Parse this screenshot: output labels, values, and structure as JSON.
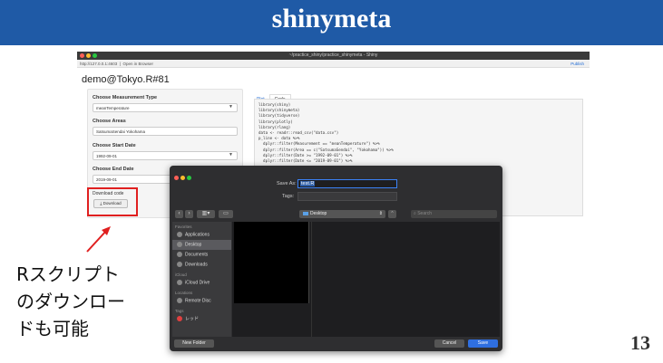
{
  "slide": {
    "title": "shinymeta",
    "page_number": "13"
  },
  "window": {
    "title": "~/practice_shiny/practice_shinymeta - Shiny",
    "url": "http://127.0.0.1:4603",
    "open_in_browser": "Open in Browser",
    "publish": "Publish",
    "traffic_colors": [
      "#ff5f57",
      "#febc2e",
      "#28c840"
    ]
  },
  "app": {
    "title": "demo@Tokyo.R#81",
    "fields": [
      {
        "label": "Choose Measurement Type",
        "value": "meanTemperature",
        "dropdown": true
      },
      {
        "label": "Choose Areas",
        "value": "SatsumaSendai   Yokohama",
        "dropdown": false
      },
      {
        "label": "Choose Start Date",
        "value": "1992-09-01",
        "dropdown": true
      },
      {
        "label": "Choose End Date",
        "value": "2019-09-01",
        "dropdown": false
      }
    ],
    "download": {
      "label": "Download code",
      "button": "Download"
    },
    "tabs": [
      "Plot",
      "Code"
    ],
    "active_tab": "Code",
    "code": "library(shiny)\nlibrary(shinymeta)\nlibrary(tidyverse)\nlibrary(plotly)\nlibrary(rlang)\ndata <- readr::read_csv(\"data.csv\")\np_line <- data %>%\n  dplyr::filter(Measurement == \"meanTemperature\") %>%\n  dplyr::filter(Area == c(\"SatsumaSendai\", \"Yokohama\")) %>%\n  dplyr::filter(Date >= \"1992-09-01\") %>%\n  dplyr::filter(Date <= \"2019-09-01\") %>%"
  },
  "dialog": {
    "save_as_label": "Save As:",
    "save_as_value": "test.R",
    "tags_label": "Tags:",
    "location": "Desktop",
    "search_placeholder": "Search",
    "sidebar": [
      {
        "heading": "Favorites",
        "items": [
          {
            "label": "Applications",
            "icon": "applications-icon",
            "selected": false
          },
          {
            "label": "Desktop",
            "icon": "desktop-icon",
            "selected": true
          },
          {
            "label": "Documents",
            "icon": "documents-icon",
            "selected": false
          },
          {
            "label": "Downloads",
            "icon": "downloads-icon",
            "selected": false
          }
        ]
      },
      {
        "heading": "iCloud",
        "items": [
          {
            "label": "iCloud Drive",
            "icon": "cloud-icon",
            "selected": false
          }
        ]
      },
      {
        "heading": "Locations",
        "items": [
          {
            "label": "Remote Disc",
            "icon": "disc-icon",
            "selected": false
          }
        ]
      },
      {
        "heading": "Tags",
        "items": [
          {
            "label": "レッド",
            "icon": "tag-red-icon",
            "selected": false
          }
        ]
      }
    ],
    "buttons": {
      "new_folder": "New Folder",
      "cancel": "Cancel",
      "save": "Save"
    }
  },
  "annotation": {
    "lines": [
      "Rスクリプト",
      "のダウンロー",
      "ドも可能"
    ],
    "highlight_color": "#e02020"
  }
}
